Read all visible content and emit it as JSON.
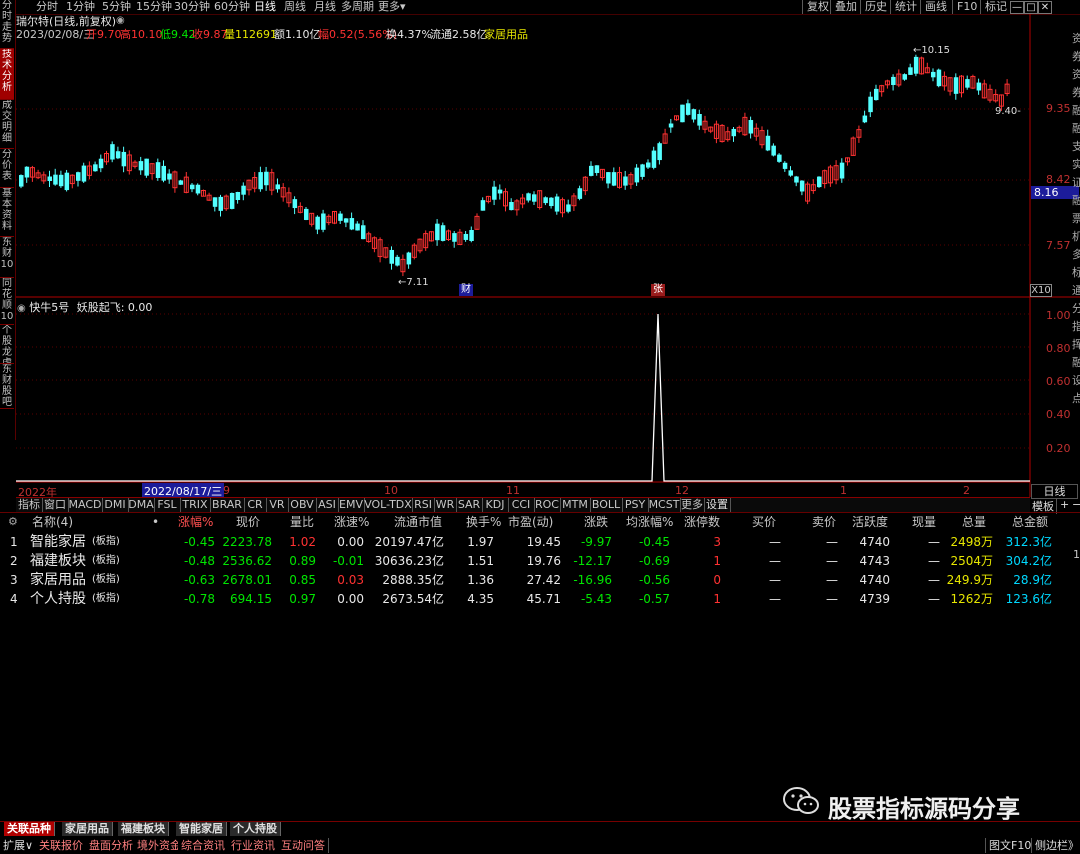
{
  "left_tabs": [
    "分时走势",
    "技术分析",
    "成交明细",
    "分价表",
    "基本资料",
    "东财10",
    "同花顺10",
    "个股龙虎",
    "东财股吧"
  ],
  "periods": [
    "分时",
    "1分钟",
    "5分钟",
    "15分钟",
    "30分钟",
    "60分钟",
    "日线",
    "周线",
    "月线",
    "多周期",
    "更多"
  ],
  "top_buttons": [
    "复权",
    "叠加",
    "历史",
    "统计",
    "画线",
    "F10",
    "标记"
  ],
  "stock": {
    "title": "瑞尔特(日线,前复权)",
    "date": "2023/02/08/三",
    "open": "开9.70",
    "high": "高10.10",
    "low": "低9.42",
    "close": "收9.87",
    "volume": "量112691",
    "amount": "额1.10亿",
    "change": "幅0.52(5.56%)",
    "turnover": "换4.37%",
    "float": "流通2.58亿",
    "industry": "家居用品"
  },
  "price_axis": [
    "9.35",
    "8.42",
    "7.57"
  ],
  "price_current": "8.16",
  "price_markers": {
    "high": "10.15",
    "low": "7.11",
    "last": "9.40"
  },
  "main_badges": [
    "财",
    "张"
  ],
  "zoom_label": "X10",
  "indicator": {
    "name": "快牛5号",
    "line_label": "妖股起飞: 0.00",
    "axis": [
      "1.00",
      "0.80",
      "0.60",
      "0.40",
      "0.20"
    ],
    "spike_value": 1.0
  },
  "date_axis": {
    "labels": [
      "2022年",
      "2022/08/17/三",
      "9",
      "10",
      "11",
      "12",
      "1",
      "2"
    ],
    "period_button": "日线"
  },
  "indicator_tabs": [
    "指标",
    "窗口",
    "MACD",
    "DMI",
    "DMA",
    "FSL",
    "TRIX",
    "BRAR",
    "CR",
    "VR",
    "OBV",
    "ASI",
    "EMV",
    "VOL-TDX",
    "RSI",
    "WR",
    "SAR",
    "KDJ",
    "CCI",
    "ROC",
    "MTM",
    "BOLL",
    "PSY",
    "MCST",
    "更多",
    "设置"
  ],
  "indicator_right": [
    "模板",
    "+",
    "−"
  ],
  "table": {
    "headers": [
      "名称(4)",
      "•",
      "涨幅%",
      "现价",
      "量比",
      "涨速%",
      "流通市值",
      "换手%",
      "市盈(动)",
      "涨跌",
      "均涨幅%",
      "涨停数",
      "买价",
      "卖价",
      "活跃度",
      "现量",
      "总量",
      "总金额"
    ],
    "rows": [
      {
        "idx": "1",
        "name": "智能家居",
        "tag": "(板指)",
        "pct": "-0.45",
        "price": "2223.78",
        "vr": "1.02",
        "speed": "0.00",
        "mcap": "20197.47亿",
        "turn": "1.97",
        "pe": "19.45",
        "chg": "-9.97",
        "avg": "-0.45",
        "limit": "3",
        "bid": "—",
        "ask": "—",
        "act": "4740",
        "cur": "—",
        "vol": "2498万",
        "amt": "312.3亿"
      },
      {
        "idx": "2",
        "name": "福建板块",
        "tag": "(板指)",
        "pct": "-0.48",
        "price": "2536.62",
        "vr": "0.89",
        "speed": "-0.01",
        "mcap": "30636.23亿",
        "turn": "1.51",
        "pe": "19.76",
        "chg": "-12.17",
        "avg": "-0.69",
        "limit": "1",
        "bid": "—",
        "ask": "—",
        "act": "4743",
        "cur": "—",
        "vol": "2504万",
        "amt": "304.2亿"
      },
      {
        "idx": "3",
        "name": "家居用品",
        "tag": "(板指)",
        "pct": "-0.63",
        "price": "2678.01",
        "vr": "0.85",
        "speed": "0.03",
        "mcap": "2888.35亿",
        "turn": "1.36",
        "pe": "27.42",
        "chg": "-16.96",
        "avg": "-0.56",
        "limit": "0",
        "bid": "—",
        "ask": "—",
        "act": "4740",
        "cur": "—",
        "vol": "249.9万",
        "amt": "28.9亿"
      },
      {
        "idx": "4",
        "name": "个人持股",
        "tag": "(板指)",
        "pct": "-0.78",
        "price": "694.15",
        "vr": "0.97",
        "speed": "0.00",
        "mcap": "2673.54亿",
        "turn": "4.35",
        "pe": "45.71",
        "chg": "-5.43",
        "avg": "-0.57",
        "limit": "1",
        "bid": "—",
        "ask": "—",
        "act": "4739",
        "cur": "—",
        "vol": "1262万",
        "amt": "123.6亿"
      }
    ]
  },
  "watermark": "股票指标源码分享",
  "right_side_text": "资券资券融融支实证融票机多标通分指挥融设点个人",
  "bottom_tabs": [
    "关联品种",
    "家居用品",
    "福建板块",
    "智能家居",
    "个人持股"
  ],
  "bottom_buttons": [
    "扩展∨",
    "关联报价",
    "盘面分析",
    "境外资金",
    "综合资讯",
    "行业资讯",
    "互动问答"
  ],
  "bottom_right": [
    "图文F10",
    "侧边栏》"
  ],
  "colors": {
    "up": "#ff3232",
    "down": "#00e600",
    "candle_down": "#54ffff",
    "axis": "#b00000",
    "bg": "#000000"
  }
}
